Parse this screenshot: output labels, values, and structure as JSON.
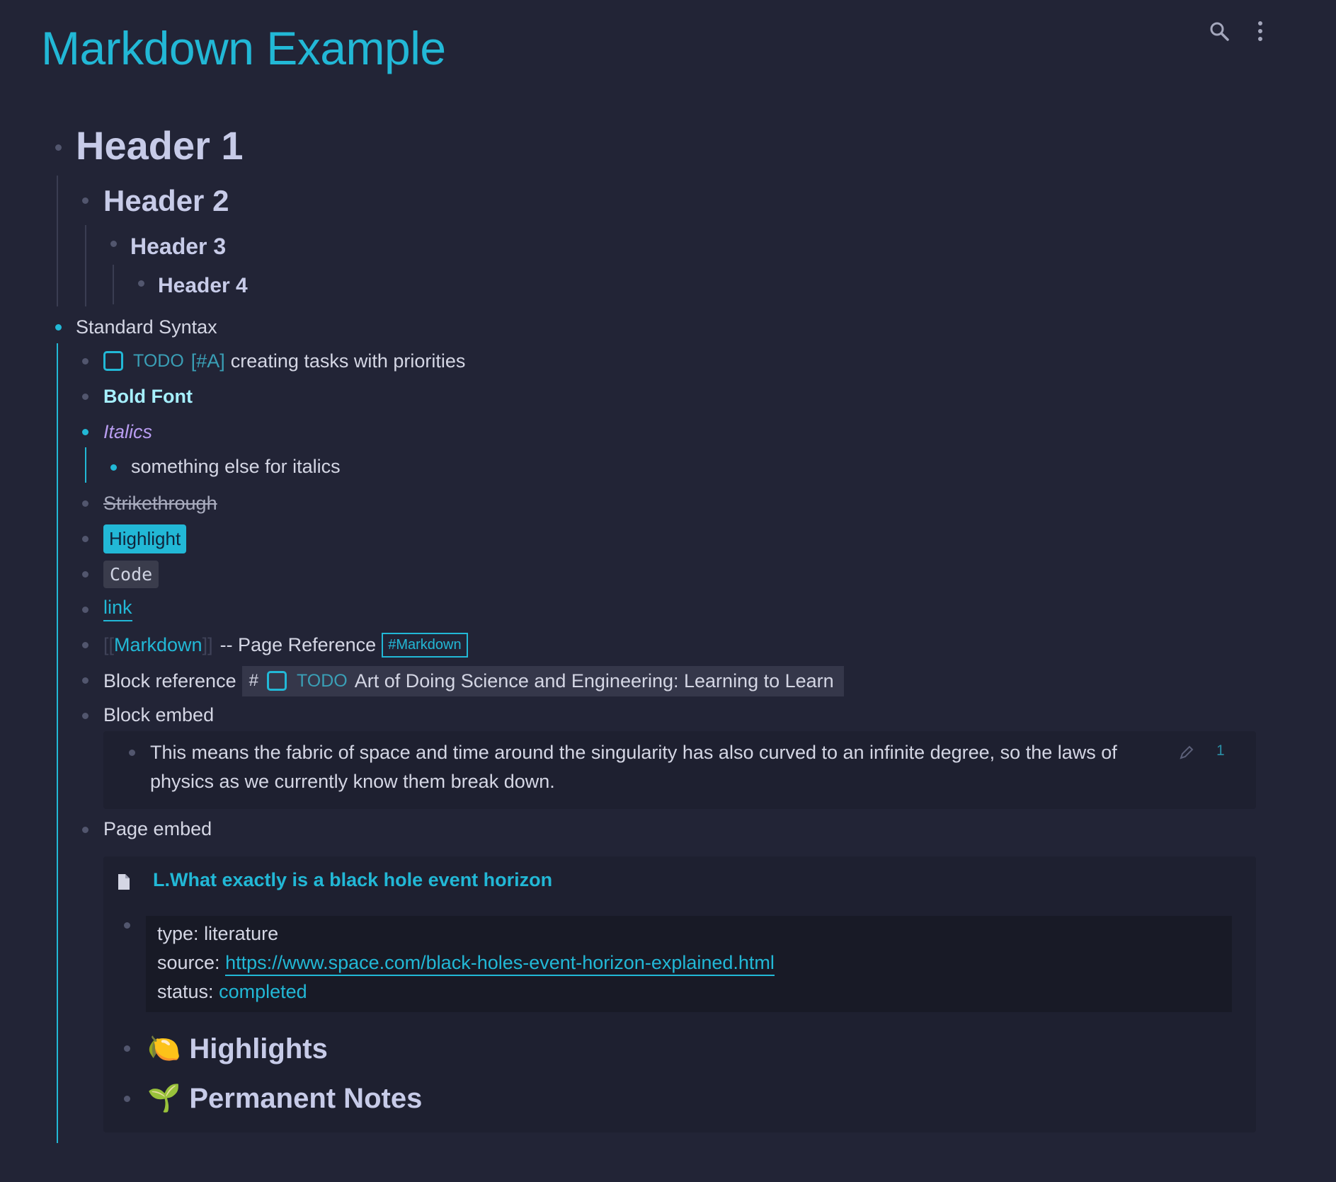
{
  "page": {
    "title": "Markdown Example"
  },
  "toolbar": {
    "search_icon": "search-icon",
    "more_icon": "more-vertical-icon"
  },
  "headers": {
    "h1": "Header 1",
    "h2": "Header 2",
    "h3": "Header 3",
    "h4": "Header 4"
  },
  "standard": {
    "label": "Standard Syntax",
    "todo_marker": "TODO",
    "todo_priority": "[#A]",
    "todo_text": "creating tasks with priorities",
    "bold": "Bold Font",
    "italic": "Italics",
    "italic_child": "something else for italics",
    "strike": "Strikethrough",
    "highlight": "Highlight",
    "code": "Code",
    "link": "link",
    "page_ref_open": "[[",
    "page_ref_name": "Markdown",
    "page_ref_close": "]]",
    "page_ref_suffix": "-- Page Reference",
    "tag": "#Markdown",
    "block_ref_label": "Block reference",
    "block_ref_hash": "#",
    "block_ref_todo": "TODO",
    "block_ref_text": "Art of Doing Science and Engineering: Learning to Learn",
    "block_embed_label": "Block embed",
    "block_embed_text_1": "This means the fabric of space and time around the singularity has also curved to an infinite degree, so the laws of",
    "block_embed_text_2": "physics as we currently know them break down.",
    "block_embed_count": "1",
    "page_embed_label": "Page embed"
  },
  "page_embed": {
    "title": "L.What exactly is a black hole event horizon",
    "type_key": "type:",
    "type_val": "literature",
    "source_key": "source:",
    "source_val": "https://www.space.com/black-holes-event-horizon-explained.html",
    "status_key": "status:",
    "status_val": "completed",
    "highlights": "Highlights",
    "highlights_icon": "🍋",
    "permanent": "Permanent Notes",
    "permanent_icon": "🌱"
  },
  "colors": {
    "accent": "#22b8d6",
    "background": "#222436",
    "text": "#d4d6e4",
    "heading": "#c7cbe8",
    "italic": "#b89cf0"
  }
}
